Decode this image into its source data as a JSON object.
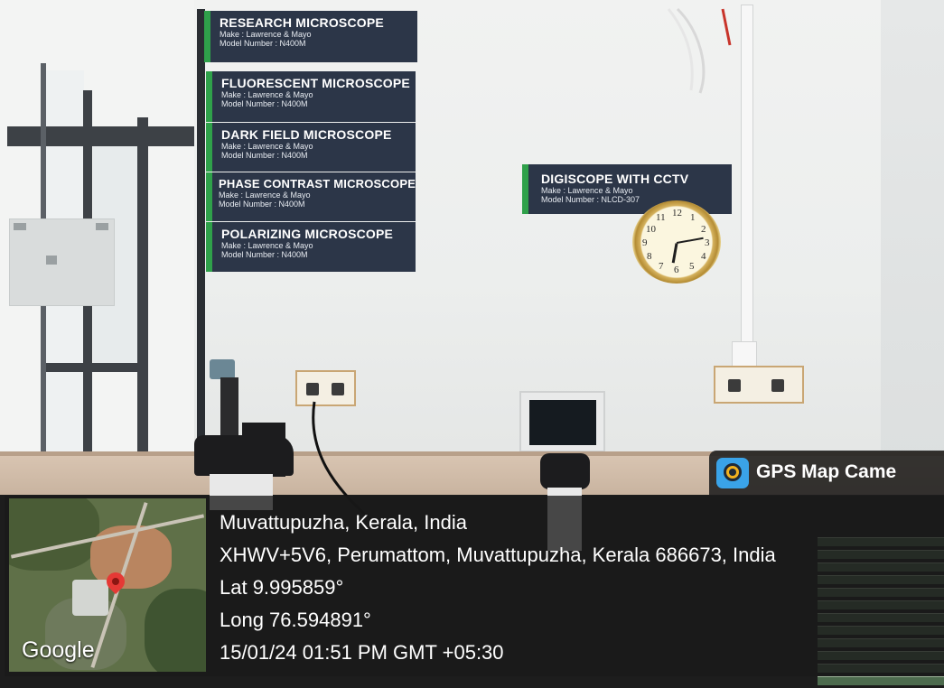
{
  "signs": [
    {
      "title": "RESEARCH MICROSCOPE",
      "make": "Make : Lawrence & Mayo",
      "model": "Model Number : N400M"
    },
    {
      "title": "FLUORESCENT MICROSCOPE",
      "make": "Make : Lawrence & Mayo",
      "model": "Model Number : N400M"
    },
    {
      "title": "DARK FIELD MICROSCOPE",
      "make": "Make : Lawrence & Mayo",
      "model": "Model Number : N400M"
    },
    {
      "title": "PHASE CONTRAST MICROSCOPE",
      "make": "Make : Lawrence & Mayo",
      "model": "Model Number : N400M"
    },
    {
      "title": "POLARIZING MICROSCOPE",
      "make": "Make : Lawrence & Mayo",
      "model": "Model Number : N400M"
    }
  ],
  "digiscope_sign": {
    "title": "DIGISCOPE WITH CCTV",
    "make": "Make : Lawrence & Mayo",
    "model": "Model Number : NLCD-307"
  },
  "clock_numbers": [
    "12",
    "1",
    "2",
    "3",
    "4",
    "5",
    "6",
    "7",
    "8",
    "9",
    "10",
    "11"
  ],
  "gps_overlay": {
    "app_name": "GPS Map Came",
    "map_brand": "Google",
    "place": "Muvattupuzha, Kerala, India",
    "address": "XHWV+5V6, Perumattom, Muvattupuzha, Kerala 686673, India",
    "latitude": "Lat 9.995859°",
    "longitude": "Long 76.594891°",
    "timestamp": "15/01/24 01:51 PM GMT +05:30"
  },
  "colors": {
    "sign_background": "#2c3648",
    "sign_accent": "#2fa14a",
    "overlay_background": "#191919",
    "map_pin": "#e53935"
  },
  "icons": [
    "gps-map-camera-logo-icon",
    "map-pin-icon"
  ]
}
